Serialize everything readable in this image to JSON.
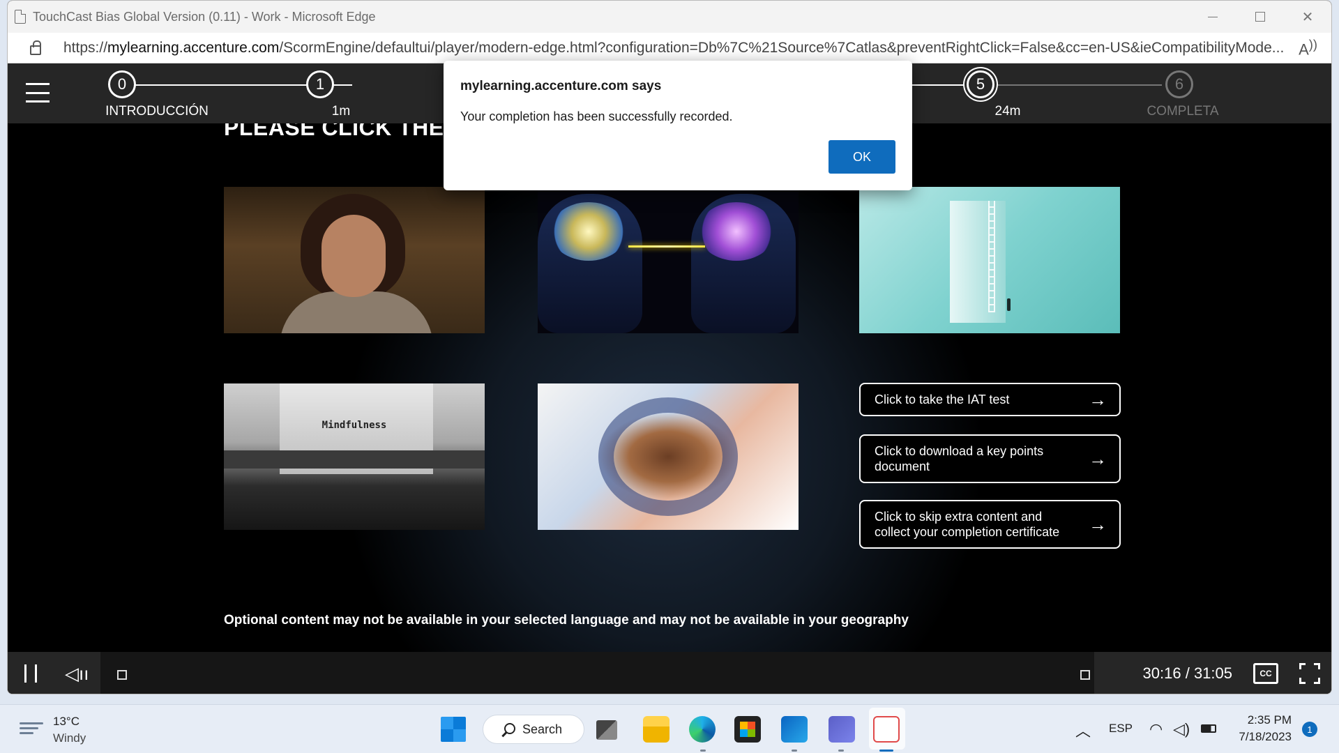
{
  "browser": {
    "window_title": "TouchCast Bias Global Version (0.11) - Work - Microsoft Edge",
    "url_prefix": "https://",
    "url_domain": "mylearning.accenture.com",
    "url_path": "/ScormEngine/defaultui/player/modern-edge.html?configuration=Db%7C%21Source%7Catlas&preventRightClick=False&cc=en-US&ieCompatibilityMode..."
  },
  "player": {
    "steps": [
      {
        "number": "0",
        "label": "INTRODUCCIÓN"
      },
      {
        "number": "1",
        "label": "1m"
      },
      {
        "number": "5",
        "label": "24m"
      },
      {
        "number": "6",
        "label": "COMPLETA"
      }
    ],
    "heading": "PLEASE CLICK THE",
    "tiles": {
      "typewriter_word": "Mindfulness"
    },
    "ctas": [
      {
        "label": "Click to take the IAT test"
      },
      {
        "label": "Click to download a key points document"
      },
      {
        "label": "Click to skip extra content and collect your completion certificate"
      }
    ],
    "disclaimer": "Optional content may not be available in your selected language and may not be available in your geography",
    "controls": {
      "time": "30:16 / 31:05",
      "cc_label": "CC"
    }
  },
  "dialog": {
    "title": "mylearning.accenture.com says",
    "message": "Your completion has been successfully recorded.",
    "ok_label": "OK"
  },
  "taskbar": {
    "weather_temp": "13°C",
    "weather_desc": "Windy",
    "search_label": "Search",
    "language": "ESP",
    "time": "2:35 PM",
    "date": "7/18/2023",
    "notification_count": "1"
  },
  "colors": {
    "accent_blue": "#0f6cbd",
    "player_bar": "#262626"
  }
}
